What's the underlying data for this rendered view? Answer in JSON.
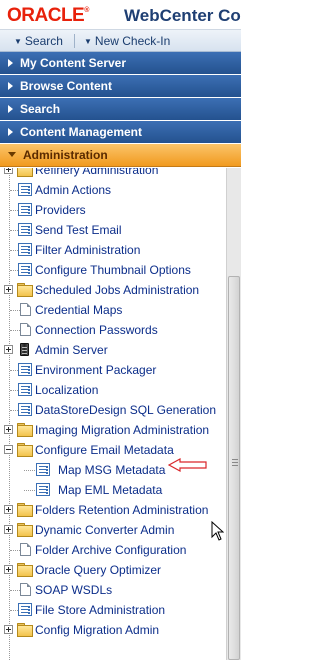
{
  "header": {
    "logo_text": "ORACLE",
    "logo_registered": "®",
    "product": "WebCenter Co"
  },
  "quickbar": {
    "search_label": "Search",
    "checkin_label": "New Check-In"
  },
  "sections": [
    {
      "label": "My Content Server"
    },
    {
      "label": "Browse Content"
    },
    {
      "label": "Search"
    },
    {
      "label": "Content Management"
    },
    {
      "label": "Administration"
    }
  ],
  "tree": {
    "items": [
      {
        "label": "Refinery Administration",
        "icon": "folder-icon",
        "expander": "plus"
      },
      {
        "label": "Admin Actions",
        "icon": "form-icon"
      },
      {
        "label": "Providers",
        "icon": "form-icon"
      },
      {
        "label": "Send Test Email",
        "icon": "form-icon"
      },
      {
        "label": "Filter Administration",
        "icon": "form-icon"
      },
      {
        "label": "Configure Thumbnail Options",
        "icon": "form-icon"
      },
      {
        "label": "Scheduled Jobs Administration",
        "icon": "folder-icon",
        "expander": "plus"
      },
      {
        "label": "Credential Maps",
        "icon": "document-icon"
      },
      {
        "label": "Connection Passwords",
        "icon": "document-icon"
      },
      {
        "label": "Admin Server",
        "icon": "server-icon",
        "expander": "plus"
      },
      {
        "label": "Environment Packager",
        "icon": "form-icon"
      },
      {
        "label": "Localization",
        "icon": "form-icon"
      },
      {
        "label": "DataStoreDesign SQL Generation",
        "icon": "form-icon"
      },
      {
        "label": "Imaging Migration Administration",
        "icon": "folder-icon",
        "expander": "plus"
      },
      {
        "label": "Configure Email Metadata",
        "icon": "folder-icon",
        "expander": "minus"
      },
      {
        "label": "Map MSG Metadata",
        "icon": "form-icon"
      },
      {
        "label": "Map EML Metadata",
        "icon": "form-icon"
      },
      {
        "label": "Folders Retention Administration",
        "icon": "folder-icon",
        "expander": "plus"
      },
      {
        "label": "Dynamic Converter Admin",
        "icon": "folder-icon",
        "expander": "plus"
      },
      {
        "label": "Folder Archive Configuration",
        "icon": "document-icon"
      },
      {
        "label": "Oracle Query Optimizer",
        "icon": "folder-icon",
        "expander": "plus"
      },
      {
        "label": "SOAP WSDLs",
        "icon": "document-icon"
      },
      {
        "label": "File Store Administration",
        "icon": "form-icon"
      },
      {
        "label": "Config Migration Admin",
        "icon": "folder-icon",
        "expander": "plus"
      }
    ]
  },
  "colors": {
    "section_bar": "#2f60a3",
    "active_section": "#f5a623",
    "link_text": "#0b2d8a",
    "logo_red": "#e8210b",
    "annotation_arrow": "#d9262b"
  }
}
